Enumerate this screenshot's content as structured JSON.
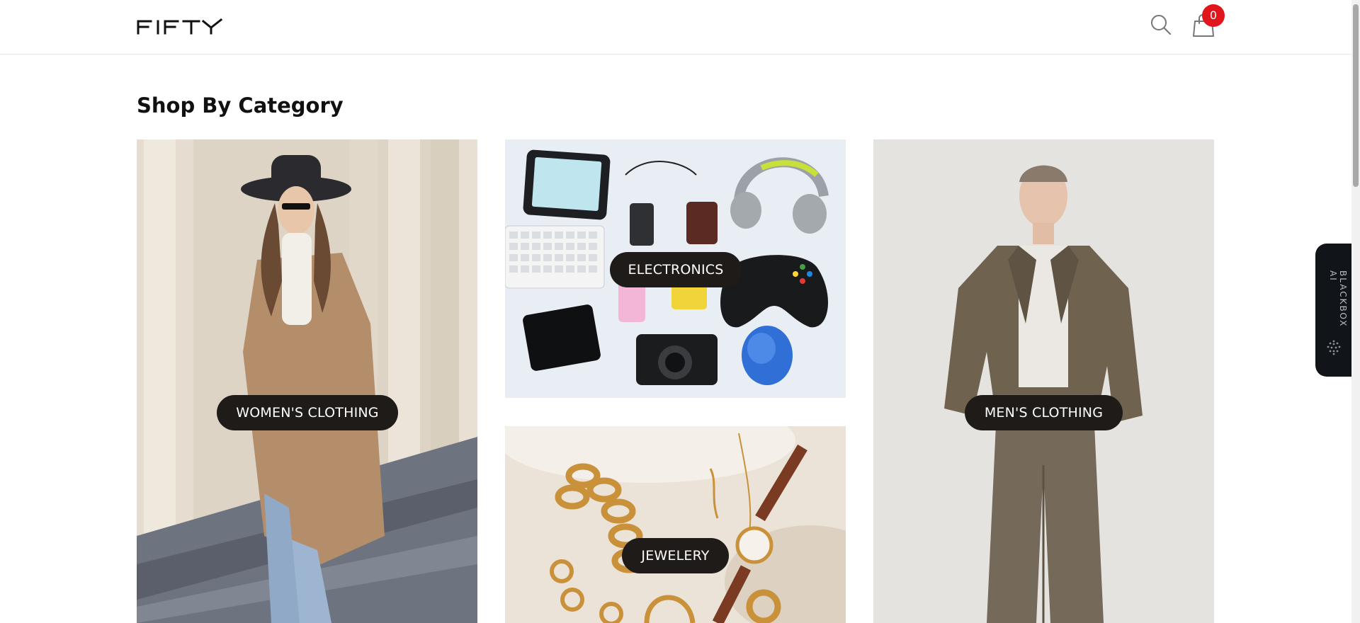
{
  "header": {
    "logo_text": "FIFTY",
    "search_icon": "search-icon",
    "cart_icon": "shopping-bag-icon",
    "cart_count": "0"
  },
  "main": {
    "section_title": "Shop By Category",
    "categories": [
      {
        "label": "WOMEN'S CLOTHING"
      },
      {
        "label": "ELECTRONICS"
      },
      {
        "label": "JEWELERY"
      },
      {
        "label": "MEN'S CLOTHING"
      }
    ]
  },
  "side_widget": {
    "label": "BLACKBOX AI",
    "icon": "dot-grid-icon"
  },
  "colors": {
    "badge": "#e0161c",
    "pill_bg": "#1f1b19",
    "text": "#111111",
    "widget_bg": "#111418"
  }
}
